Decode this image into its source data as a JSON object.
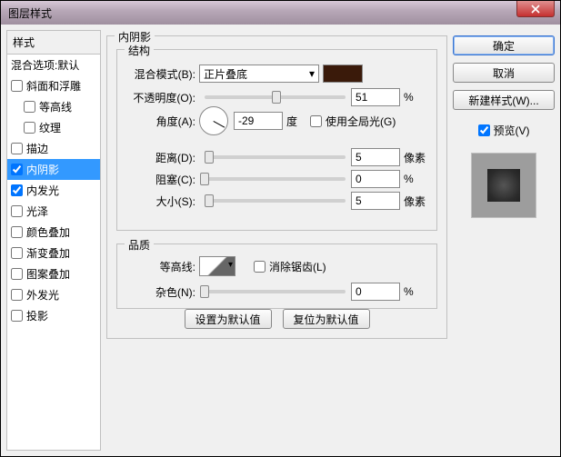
{
  "window": {
    "title": "图层样式"
  },
  "styles": {
    "header": "样式",
    "blendOptions": "混合选项:默认",
    "items": [
      {
        "label": "斜面和浮雕",
        "checked": false
      },
      {
        "label": "等高线",
        "checked": false,
        "indent": true
      },
      {
        "label": "纹理",
        "checked": false,
        "indent": true
      },
      {
        "label": "描边",
        "checked": false
      },
      {
        "label": "内阴影",
        "checked": true,
        "selected": true
      },
      {
        "label": "内发光",
        "checked": true
      },
      {
        "label": "光泽",
        "checked": false
      },
      {
        "label": "颜色叠加",
        "checked": false
      },
      {
        "label": "渐变叠加",
        "checked": false
      },
      {
        "label": "图案叠加",
        "checked": false
      },
      {
        "label": "外发光",
        "checked": false
      },
      {
        "label": "投影",
        "checked": false
      }
    ]
  },
  "panel": {
    "title": "内阴影",
    "structure": {
      "title": "结构",
      "blendMode": {
        "label": "混合模式(B):",
        "value": "正片叠底",
        "color": "#3a1a0a"
      },
      "opacity": {
        "label": "不透明度(O):",
        "value": "51",
        "unit": "%",
        "pct": 51
      },
      "angle": {
        "label": "角度(A):",
        "value": "-29",
        "unit": "度",
        "global": {
          "label": "使用全局光(G)",
          "checked": false
        }
      },
      "distance": {
        "label": "距离(D):",
        "value": "5",
        "unit": "像素",
        "pct": 3
      },
      "choke": {
        "label": "阻塞(C):",
        "value": "0",
        "unit": "%",
        "pct": 0
      },
      "size": {
        "label": "大小(S):",
        "value": "5",
        "unit": "像素",
        "pct": 3
      }
    },
    "quality": {
      "title": "品质",
      "contour": {
        "label": "等高线:",
        "antialias": {
          "label": "消除锯齿(L)",
          "checked": false
        }
      },
      "noise": {
        "label": "杂色(N):",
        "value": "0",
        "unit": "%",
        "pct": 0
      }
    },
    "buttons": {
      "setDefault": "设置为默认值",
      "resetDefault": "复位为默认值"
    }
  },
  "right": {
    "ok": "确定",
    "cancel": "取消",
    "newStyle": "新建样式(W)...",
    "preview": {
      "label": "预览(V)",
      "checked": true
    }
  }
}
